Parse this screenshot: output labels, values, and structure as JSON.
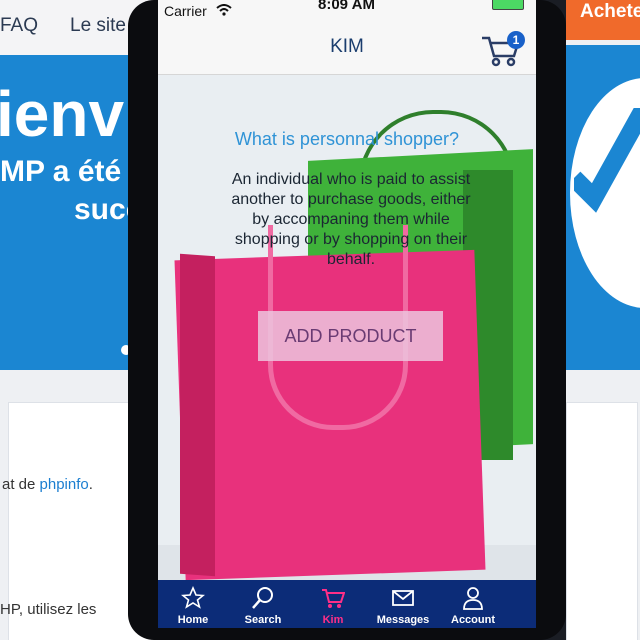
{
  "bg_left": {
    "nav_faq": "FAQ",
    "nav_site": "Le site",
    "hero_big": "ienv",
    "hero_line2": "MP a été",
    "hero_line3": "succ",
    "para1_prefix": "at de ",
    "para1_link": "phpinfo",
    "para1_suffix": ".",
    "para2": "HP, utilisez les"
  },
  "bg_right": {
    "cta": "Acheter"
  },
  "status": {
    "carrier": "Carrier",
    "time": "8:09 AM"
  },
  "header": {
    "title": "KIM",
    "cart_count": "1"
  },
  "content": {
    "question": "What is personnal shopper?",
    "answer": "An individual who is paid to assist another to purchase goods, either by accompaning them while shopping or by shopping on their behalf.",
    "add_button": "ADD PRODUCT"
  },
  "tabs": [
    {
      "label": "Home",
      "icon": "star-icon"
    },
    {
      "label": "Search",
      "icon": "search-icon"
    },
    {
      "label": "Kim",
      "icon": "cart-icon",
      "active": true
    },
    {
      "label": "Messages",
      "icon": "envelope-icon"
    },
    {
      "label": "Account",
      "icon": "user-icon"
    }
  ],
  "colors": {
    "tab_bg": "#0c2c78",
    "active_tab": "#ff2f87",
    "badge": "#1961c9",
    "question": "#2f93d6"
  }
}
